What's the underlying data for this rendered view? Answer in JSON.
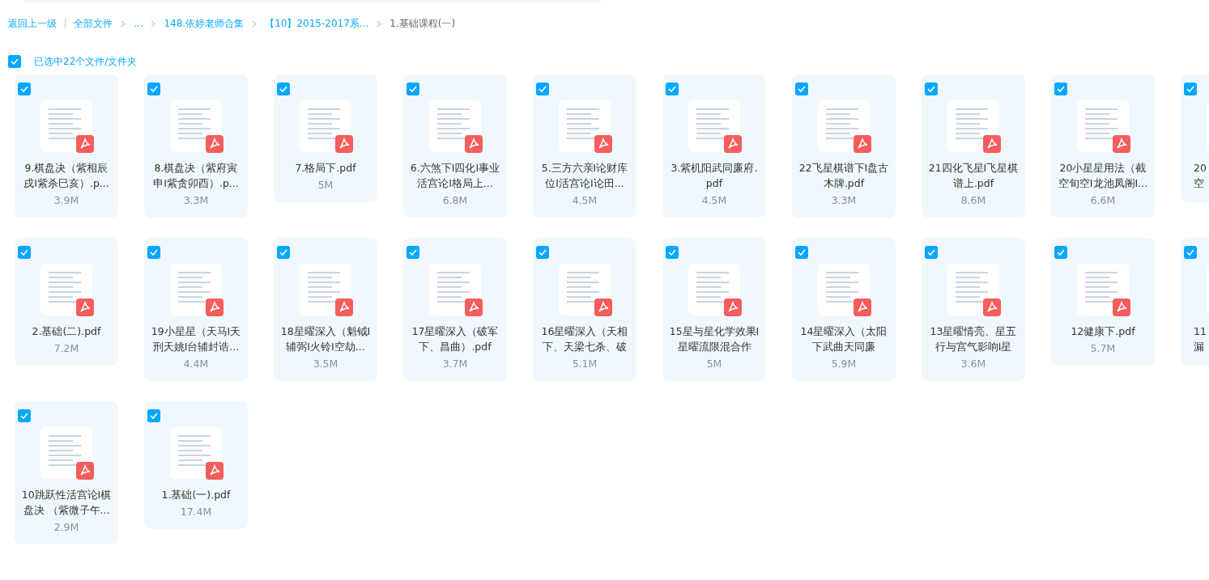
{
  "breadcrumb": {
    "back": "返回上一级",
    "items": [
      {
        "label": "全部文件",
        "current": false
      },
      {
        "label": "...",
        "current": false
      },
      {
        "label": "148.依婷老师合集",
        "current": false
      },
      {
        "label": "【10】2015-2017系...",
        "current": false
      },
      {
        "label": "1.基础课程(一)",
        "current": true
      }
    ]
  },
  "selection": {
    "checked": true,
    "label": "已选中22个文件/文件夹"
  },
  "files": [
    {
      "kind": "full",
      "checked": true,
      "name": [
        "9.棋盘决（紫相辰",
        "戌I紫杀巳亥）.p..."
      ],
      "size": "3.9M"
    },
    {
      "kind": "full",
      "checked": true,
      "name": [
        "8.棋盘决（紫府寅",
        "申I紫贪卯酉）.p..."
      ],
      "size": "3.3M"
    },
    {
      "kind": "full",
      "checked": true,
      "name": [
        "7.格局下.pdf"
      ],
      "size": "5M"
    },
    {
      "kind": "full",
      "checked": true,
      "name": [
        "6.六煞下I四化I事业",
        "活宫论I格局上..."
      ],
      "size": "6.8M"
    },
    {
      "kind": "full",
      "checked": true,
      "name": [
        "5.三方六亲I论财库",
        "位I活宫论I论田..."
      ],
      "size": "4.5M"
    },
    {
      "kind": "full",
      "checked": true,
      "name": [
        "3.紫机阳武同廉府.",
        "pdf"
      ],
      "size": "4.5M"
    },
    {
      "kind": "full",
      "checked": true,
      "name": [
        "22飞星棋谱下I盘古",
        "木牌.pdf"
      ],
      "size": "3.3M"
    },
    {
      "kind": "full",
      "checked": true,
      "name": [
        "21四化飞星I飞星棋",
        "谱上.pdf"
      ],
      "size": "8.6M"
    },
    {
      "kind": "full",
      "checked": true,
      "name": [
        "20小星星用法（截",
        "空旬空I龙池凤阁I..."
      ],
      "size": "6.6M"
    },
    {
      "kind": "partial",
      "checked": true,
      "name": [
        "20",
        "空"
      ]
    },
    {
      "kind": "full",
      "checked": true,
      "name": [
        "2.基础(二).pdf"
      ],
      "size": "7.2M"
    },
    {
      "kind": "full",
      "checked": true,
      "name": [
        "19小星星（天马I天",
        "刑天姚I台辅封诰..."
      ],
      "size": "4.4M"
    },
    {
      "kind": "full",
      "checked": true,
      "name": [
        "18星曜深入（魁钺I",
        "辅弼I火铃I空劫..."
      ],
      "size": "3.5M"
    },
    {
      "kind": "full",
      "checked": true,
      "name": [
        "17星曜深入（破军",
        "下、昌曲）.pdf"
      ],
      "size": "3.7M"
    },
    {
      "kind": "full",
      "checked": true,
      "name": [
        "16星曜深入（天相",
        "下、天梁七杀、破"
      ],
      "size": "5.1M"
    },
    {
      "kind": "full",
      "checked": true,
      "name": [
        "15星与星化学效果I",
        "星曜流限混合作"
      ],
      "size": "5M"
    },
    {
      "kind": "full",
      "checked": true,
      "name": [
        "14星曜深入（太阳",
        "下武曲天同廉"
      ],
      "size": "5.9M"
    },
    {
      "kind": "full",
      "checked": true,
      "name": [
        "13星曜情亮、星五",
        "行与宫气影响I星"
      ],
      "size": "3.6M"
    },
    {
      "kind": "full",
      "checked": true,
      "name": [
        "12健康下.pdf"
      ],
      "size": "5.7M"
    },
    {
      "kind": "partial",
      "checked": true,
      "name": [
        "11",
        "漏"
      ]
    },
    {
      "kind": "full",
      "checked": true,
      "name": [
        "10跳跃性活宫论I棋",
        "盘决 （紫微子午..."
      ],
      "size": "2.9M"
    },
    {
      "kind": "full",
      "checked": true,
      "name": [
        "1.基础(一).pdf"
      ],
      "size": "17.4M"
    }
  ]
}
